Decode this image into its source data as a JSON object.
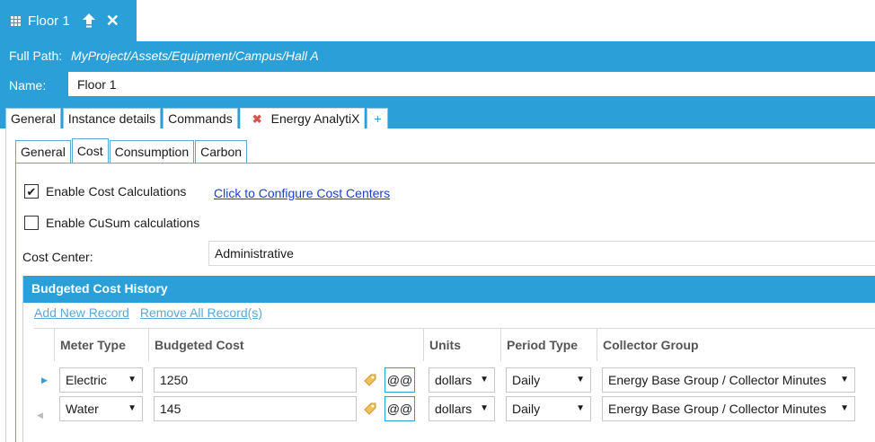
{
  "window": {
    "tab_title": "Floor 1"
  },
  "header": {
    "full_path_label": "Full Path:",
    "full_path_value": "MyProject/Assets/Equipment/Campus/Hall A",
    "name_label": "Name:",
    "name_value": "Floor 1"
  },
  "main_tabs": [
    {
      "label": "General"
    },
    {
      "label": "Instance details"
    },
    {
      "label": "Commands"
    },
    {
      "label": "Energy AnalytiX",
      "active": true
    },
    {
      "label": "+"
    }
  ],
  "sub_tabs": [
    {
      "label": "General"
    },
    {
      "label": "Cost",
      "active": true
    },
    {
      "label": "Consumption"
    },
    {
      "label": "Carbon"
    }
  ],
  "options": {
    "enable_cost_label": "Enable Cost Calculations",
    "enable_cost_checked": true,
    "configure_link": "Click to Configure Cost Centers",
    "enable_cusum_label": "Enable CuSum calculations",
    "enable_cusum_checked": false
  },
  "cost_center": {
    "label": "Cost Center:",
    "value": "Administrative"
  },
  "history": {
    "title": "Budgeted Cost History",
    "add_link": "Add New Record",
    "remove_link": "Remove All Record(s)",
    "columns": [
      "Meter Type",
      "Budgeted Cost",
      "Units",
      "Period Type",
      "Collector Group"
    ],
    "rows": [
      {
        "meter_type": "Electric",
        "budgeted_cost": "1250",
        "at": "@@",
        "units": "dollars",
        "period_type": "Daily",
        "collector_group": "Energy Base Group / Collector Minutes"
      },
      {
        "meter_type": "Water",
        "budgeted_cost": "145",
        "at": "@@",
        "units": "dollars",
        "period_type": "Daily",
        "collector_group": "Energy Base Group / Collector Minutes"
      }
    ]
  },
  "colors": {
    "accent": "#2b9fd8",
    "link": "#1a3fd6",
    "remove_mark": "#d9534f"
  }
}
